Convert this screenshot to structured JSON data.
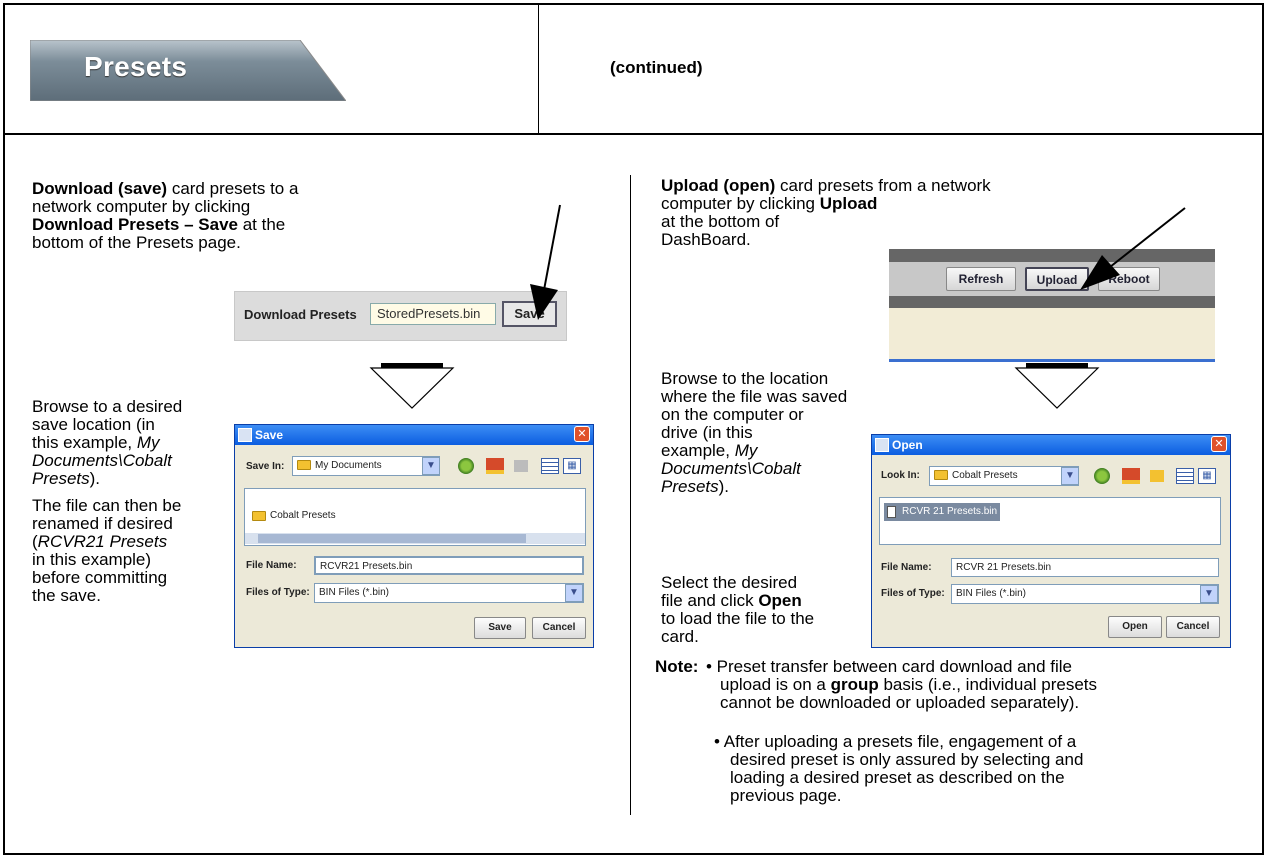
{
  "header": {
    "tab_title": "Presets",
    "continued": "(continued)"
  },
  "left": {
    "para1": {
      "b1": "Download (save)",
      "t1": " card presets to a",
      "t2": "network computer by clicking",
      "b2": "Download Presets – Save",
      "t3": " at the",
      "t4": "bottom of the Presets page."
    },
    "download_strip": {
      "label": "Download Presets",
      "value": "StoredPresets.bin",
      "button": "Save"
    },
    "para2": {
      "l1": "Browse to a desired",
      "l2": "save location (in",
      "l3": "this example, ",
      "l3i": "My",
      "l4i": "Documents\\Cobalt",
      "l5i": "Presets",
      "l5": ")."
    },
    "para3": {
      "l1": "The file can then be",
      "l2": "renamed if desired",
      "l3a": "(",
      "l3i": "RCVR21 Presets",
      "l4": "in this example)",
      "l5": "before committing",
      "l6": "the save."
    },
    "save_dialog": {
      "title": "Save",
      "save_in_label": "Save In:",
      "save_in_value": "My Documents",
      "list_item": "Cobalt Presets",
      "file_name_label": "File Name:",
      "file_name_value": "RCVR21 Presets.bin",
      "files_type_label": "Files of Type:",
      "files_type_value": "BIN Files (*.bin)",
      "save_button": "Save",
      "cancel_button": "Cancel"
    }
  },
  "right": {
    "para1": {
      "b1": "Upload (open)",
      "t1": " card presets from a network",
      "t2": "computer by clicking ",
      "b2": "Upload",
      "t3": "at the bottom of",
      "t4": "DashBoard."
    },
    "upload_strip": {
      "refresh": "Refresh",
      "upload": "Upload",
      "reboot": "Reboot"
    },
    "para2": {
      "l1": "Browse to the location",
      "l2": "where the file was saved",
      "l3": "on the computer or",
      "l4": "drive (in this",
      "l5": "example, ",
      "l5i": "My",
      "l6i": "Documents\\Cobalt",
      "l7i": "Presets",
      "l7": ")."
    },
    "para3": {
      "l1": "Select the desired",
      "l2a": "file and click ",
      "l2b": "Open",
      "l3": "to load the file to the",
      "l4": "card."
    },
    "open_dialog": {
      "title": "Open",
      "look_in_label": "Look In:",
      "look_in_value": "Cobalt Presets",
      "list_item": "RCVR 21 Presets.bin",
      "file_name_label": "File Name:",
      "file_name_value": "RCVR 21 Presets.bin",
      "files_type_label": "Files of Type:",
      "files_type_value": "BIN Files (*.bin)",
      "open_button": "Open",
      "cancel_button": "Cancel"
    },
    "note": {
      "label": "Note:",
      "b1_l1": "• Preset transfer between card download and file",
      "b1_l2a": "upload is on a ",
      "b1_l2b": "group",
      "b1_l2c": " basis (i.e., individual presets",
      "b1_l3": "cannot be downloaded or uploaded separately).",
      "b2_l1": "• After uploading a presets file, engagement of a",
      "b2_l2": "desired preset is only assured by selecting and",
      "b2_l3": "loading a desired preset as described on the",
      "b2_l4": "previous page."
    }
  }
}
